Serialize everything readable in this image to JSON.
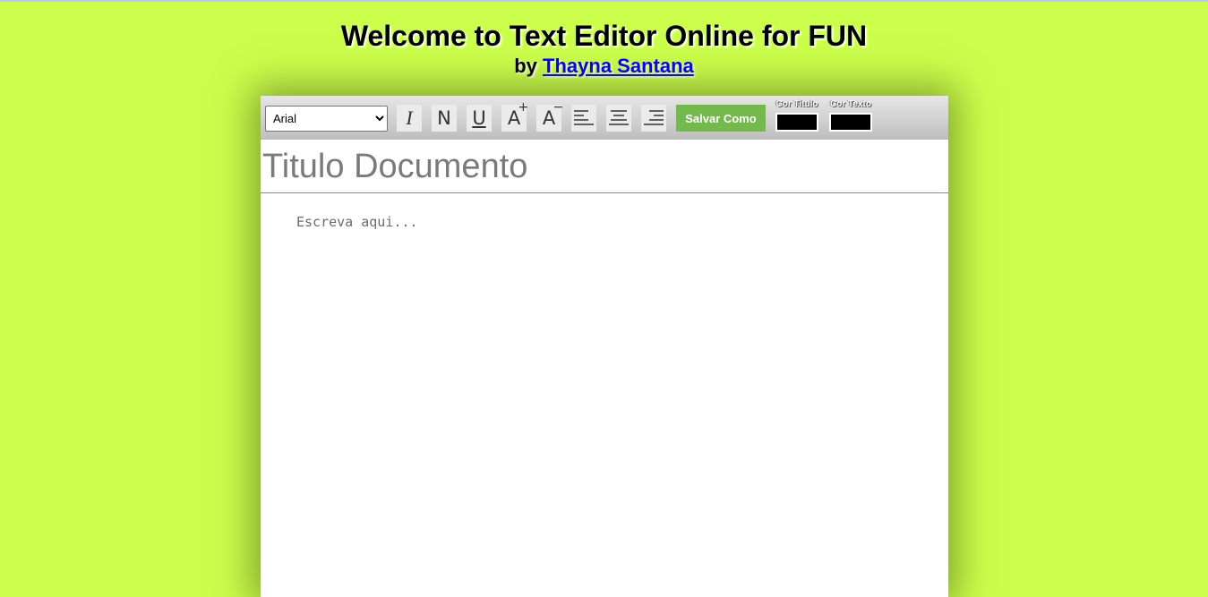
{
  "header": {
    "title": "Welcome to Text Editor Online for FUN",
    "by_prefix": "by",
    "author": "Thayna Santana"
  },
  "toolbar": {
    "font_select": {
      "selected": "Arial"
    },
    "buttons": {
      "italic": "I",
      "normal": "N",
      "underline": "U",
      "increase_font": "A",
      "decrease_font": "A"
    },
    "save_label": "Salvar Como",
    "title_color_label": "Cor Titulo",
    "text_color_label": "Cor Texto",
    "title_color": "#000000",
    "text_color": "#000000"
  },
  "document": {
    "title_placeholder": "Titulo Documento",
    "body_placeholder": "Escreva aqui..."
  },
  "colors": {
    "background": "#ccff4c",
    "save_button": "#74b94b",
    "link": "#0000ee"
  }
}
